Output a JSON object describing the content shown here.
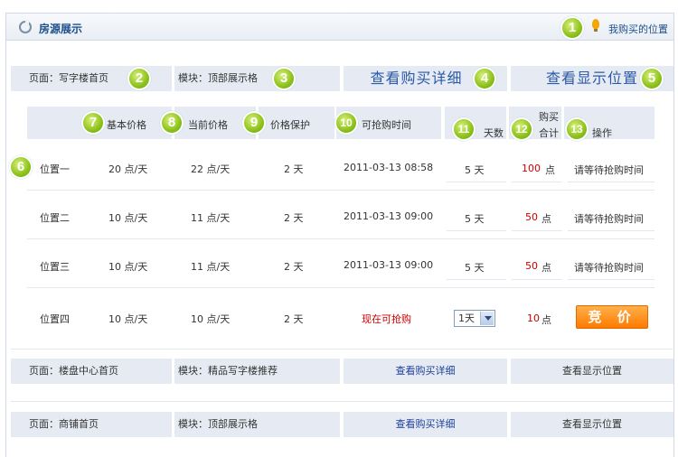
{
  "header": {
    "title": "房源展示",
    "my_position_link": "我购买的位置"
  },
  "badges": [
    "1",
    "2",
    "3",
    "4",
    "5",
    "6",
    "7",
    "8",
    "9",
    "10",
    "11",
    "12",
    "13"
  ],
  "section_top": {
    "page": "页面：写字楼首页",
    "module": "模块：顶部展示格",
    "view_detail": "查看购买详细",
    "view_position": "查看显示位置"
  },
  "columns": {
    "base_price": "基本价格",
    "current_price": "当前价格",
    "price_protect": "价格保护",
    "grab_time": "可抢购时间",
    "days": "天数",
    "total_line1": "购买",
    "total_line2": "合计",
    "action": "操作"
  },
  "rows": [
    {
      "name": "位置一",
      "base": "20 点/天",
      "current": "22 点/天",
      "protect": "2 天",
      "time": "2011-03-13 08:58",
      "days": "5 天",
      "total_num": "100",
      "total_unit": "点",
      "action": "请等待抢购时间"
    },
    {
      "name": "位置二",
      "base": "10 点/天",
      "current": "11 点/天",
      "protect": "2 天",
      "time": "2011-03-13 09:00",
      "days": "5 天",
      "total_num": "50",
      "total_unit": "点",
      "action": "请等待抢购时间"
    },
    {
      "name": "位置三",
      "base": "10 点/天",
      "current": "11 点/天",
      "protect": "2 天",
      "time": "2011-03-13 09:00",
      "days": "5 天",
      "total_num": "50",
      "total_unit": "点",
      "action": "请等待抢购时间"
    },
    {
      "name": "位置四",
      "base": "10 点/天",
      "current": "10 点/天",
      "protect": "2 天",
      "time": "现在可抢购",
      "days_select": "1天",
      "total_num": "10",
      "total_unit": "点",
      "action_button": "竞 价"
    }
  ],
  "sections": [
    {
      "page": "页面：楼盘中心首页",
      "module": "模块：精品写字楼推荐",
      "view_detail": "查看购买详细",
      "view_position": "查看显示位置"
    },
    {
      "page": "页面：商铺首页",
      "module": "模块：顶部展示格",
      "view_detail": "查看购买详细",
      "view_position": "查看显示位置"
    }
  ]
}
